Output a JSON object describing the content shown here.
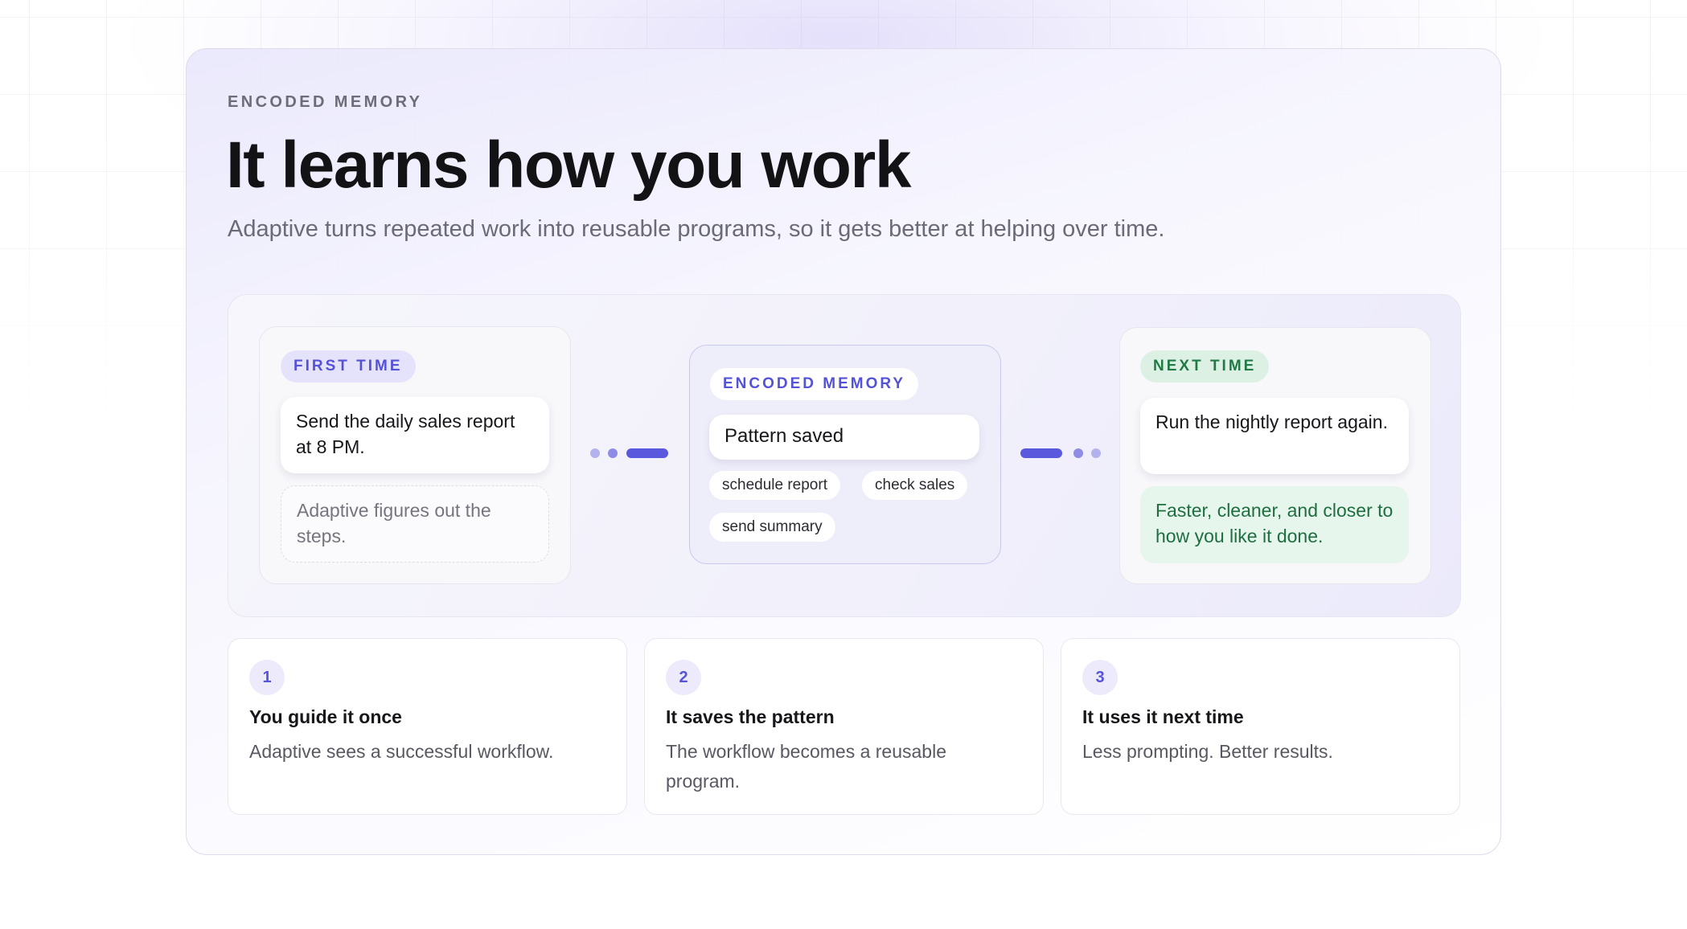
{
  "header": {
    "eyebrow": "ENCODED MEMORY",
    "title": "It learns how you work",
    "subtitle": "Adaptive turns repeated work into reusable programs, so it gets better at helping over time."
  },
  "flow": {
    "first_time": {
      "label": "FIRST TIME",
      "message": "Send the daily sales report at 8 PM.",
      "note": "Adaptive figures out the steps."
    },
    "encoded_memory": {
      "label": "ENCODED MEMORY",
      "message": "Pattern saved",
      "tags": [
        "schedule report",
        "check sales",
        "send summary"
      ]
    },
    "next_time": {
      "label": "NEXT TIME",
      "message": "Run the nightly report again.",
      "note": "Faster, cleaner, and closer to how you like it done."
    }
  },
  "steps": [
    {
      "number": "1",
      "title": "You guide it once",
      "description": "Adaptive sees a successful workflow."
    },
    {
      "number": "2",
      "title": "It saves the pattern",
      "description": "The workflow becomes a reusable program."
    },
    {
      "number": "3",
      "title": "It uses it next time",
      "description": "Less prompting. Better results."
    }
  ],
  "colors": {
    "accent": "#5a58dc",
    "accent_light": "#e5e3fb",
    "success": "#1f7a45",
    "success_bg": "#e6f6ec",
    "text": "#141418",
    "muted": "#6b6b75"
  }
}
